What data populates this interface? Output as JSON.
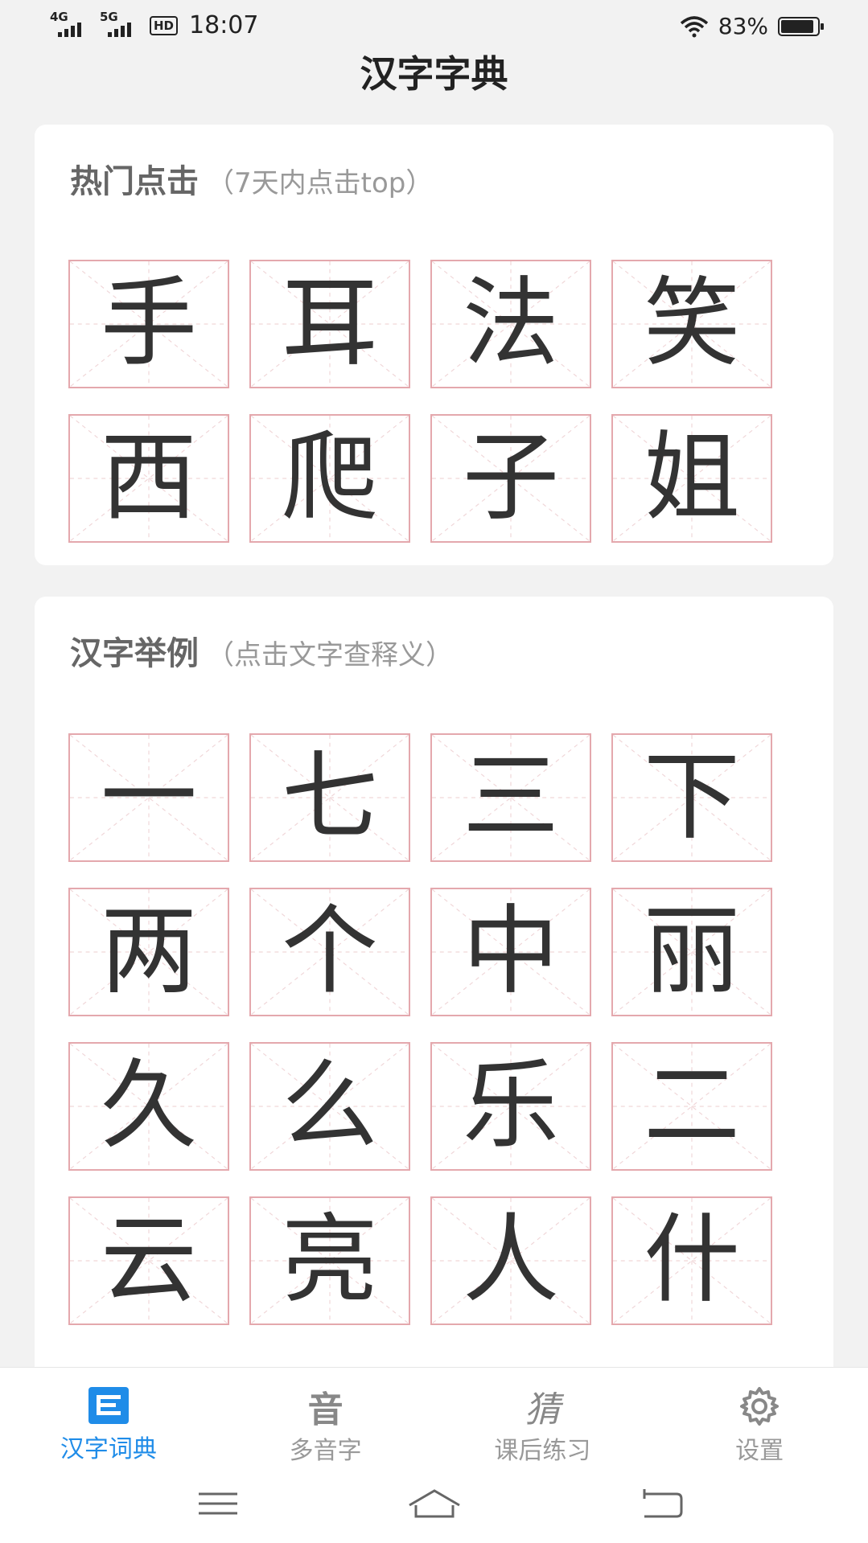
{
  "status_bar": {
    "network1": "4G",
    "network2": "5G",
    "hd": "HD",
    "time": "18:07",
    "battery": "83%"
  },
  "app_title": "汉字字典",
  "hot": {
    "title": "热门点击",
    "subtitle": "（7天内点击top）",
    "chars": [
      "手",
      "耳",
      "法",
      "笑",
      "西",
      "爬",
      "子",
      "姐"
    ]
  },
  "examples": {
    "title": "汉字举例",
    "subtitle": "（点击文字查释义）",
    "chars": [
      "一",
      "七",
      "三",
      "下",
      "两",
      "个",
      "中",
      "丽",
      "久",
      "么",
      "乐",
      "二",
      "云",
      "亮",
      "人",
      "什"
    ]
  },
  "bottom_nav": {
    "items": [
      {
        "label": "汉字词典",
        "icon": "dictionary-icon"
      },
      {
        "label": "多音字",
        "icon": "yin-char-icon",
        "glyph": "音"
      },
      {
        "label": "课后练习",
        "icon": "cai-char-icon",
        "glyph": "猜"
      },
      {
        "label": "设置",
        "icon": "gear-icon"
      }
    ]
  },
  "colors": {
    "accent": "#1f8ce8",
    "cell_border": "#e4a8ad",
    "background": "#f2f2f2"
  }
}
